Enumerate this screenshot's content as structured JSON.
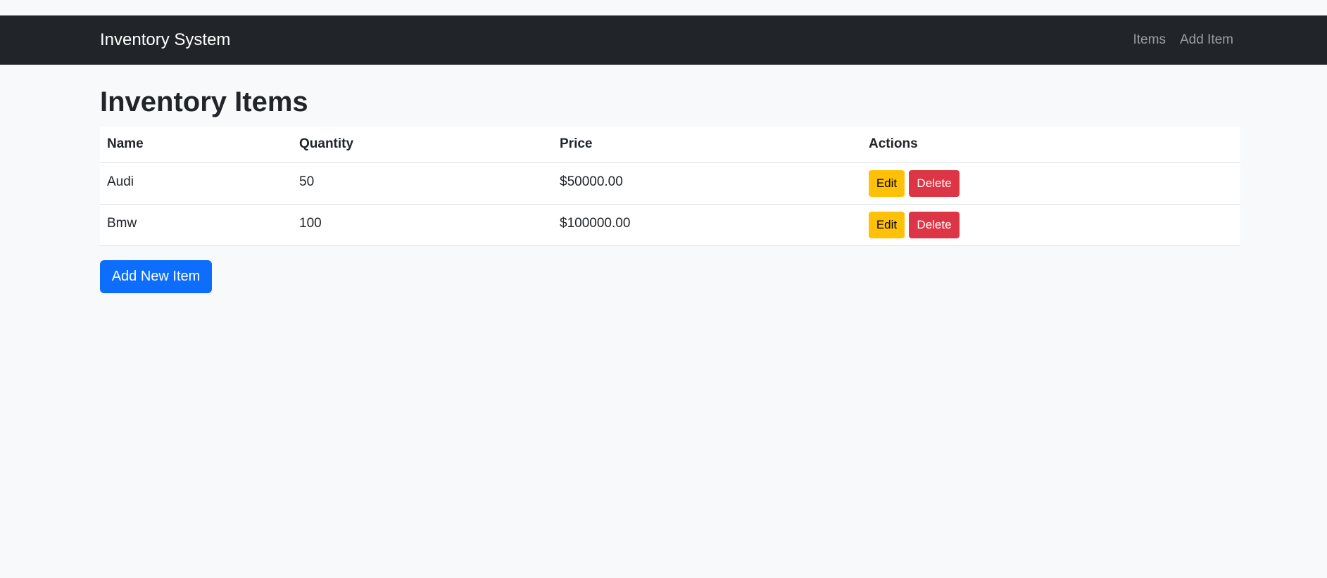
{
  "navbar": {
    "brand": "Inventory System",
    "links": [
      {
        "label": "Items"
      },
      {
        "label": "Add Item"
      }
    ]
  },
  "page": {
    "title": "Inventory Items"
  },
  "table": {
    "headers": [
      "Name",
      "Quantity",
      "Price",
      "Actions"
    ],
    "rows": [
      {
        "name": "Audi",
        "quantity": "50",
        "price": "$50000.00",
        "edit": "Edit",
        "delete": "Delete"
      },
      {
        "name": "Bmw",
        "quantity": "100",
        "price": "$100000.00",
        "edit": "Edit",
        "delete": "Delete"
      }
    ]
  },
  "actions": {
    "add_new_label": "Add New Item"
  },
  "colors": {
    "navbar_bg": "#212529",
    "page_bg": "#f8f9fa",
    "edit_button": "#ffc107",
    "delete_button": "#dc3545",
    "primary_button": "#0d6efd"
  }
}
